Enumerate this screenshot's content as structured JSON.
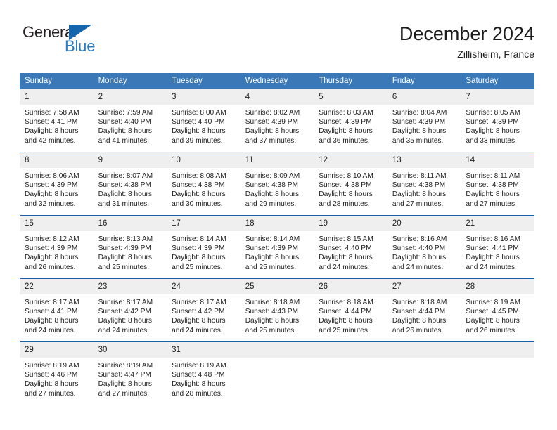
{
  "brand": {
    "name_top": "General",
    "name_bottom": "Blue",
    "triangle_icon": "blue-triangle-icon",
    "color_dark": "#231f20",
    "color_blue": "#2b7cc3"
  },
  "header": {
    "title": "December 2024",
    "location": "Zillisheim, France",
    "accent_color": "#3a78b8",
    "separator_color": "#1a5ea8",
    "daynum_band_color": "#efefef"
  },
  "weekday_headers": [
    "Sunday",
    "Monday",
    "Tuesday",
    "Wednesday",
    "Thursday",
    "Friday",
    "Saturday"
  ],
  "weeks": [
    [
      {
        "day": "1",
        "sunrise": "Sunrise: 7:58 AM",
        "sunset": "Sunset: 4:41 PM",
        "daylight1": "Daylight: 8 hours",
        "daylight2": "and 42 minutes."
      },
      {
        "day": "2",
        "sunrise": "Sunrise: 7:59 AM",
        "sunset": "Sunset: 4:40 PM",
        "daylight1": "Daylight: 8 hours",
        "daylight2": "and 41 minutes."
      },
      {
        "day": "3",
        "sunrise": "Sunrise: 8:00 AM",
        "sunset": "Sunset: 4:40 PM",
        "daylight1": "Daylight: 8 hours",
        "daylight2": "and 39 minutes."
      },
      {
        "day": "4",
        "sunrise": "Sunrise: 8:02 AM",
        "sunset": "Sunset: 4:39 PM",
        "daylight1": "Daylight: 8 hours",
        "daylight2": "and 37 minutes."
      },
      {
        "day": "5",
        "sunrise": "Sunrise: 8:03 AM",
        "sunset": "Sunset: 4:39 PM",
        "daylight1": "Daylight: 8 hours",
        "daylight2": "and 36 minutes."
      },
      {
        "day": "6",
        "sunrise": "Sunrise: 8:04 AM",
        "sunset": "Sunset: 4:39 PM",
        "daylight1": "Daylight: 8 hours",
        "daylight2": "and 35 minutes."
      },
      {
        "day": "7",
        "sunrise": "Sunrise: 8:05 AM",
        "sunset": "Sunset: 4:39 PM",
        "daylight1": "Daylight: 8 hours",
        "daylight2": "and 33 minutes."
      }
    ],
    [
      {
        "day": "8",
        "sunrise": "Sunrise: 8:06 AM",
        "sunset": "Sunset: 4:39 PM",
        "daylight1": "Daylight: 8 hours",
        "daylight2": "and 32 minutes."
      },
      {
        "day": "9",
        "sunrise": "Sunrise: 8:07 AM",
        "sunset": "Sunset: 4:38 PM",
        "daylight1": "Daylight: 8 hours",
        "daylight2": "and 31 minutes."
      },
      {
        "day": "10",
        "sunrise": "Sunrise: 8:08 AM",
        "sunset": "Sunset: 4:38 PM",
        "daylight1": "Daylight: 8 hours",
        "daylight2": "and 30 minutes."
      },
      {
        "day": "11",
        "sunrise": "Sunrise: 8:09 AM",
        "sunset": "Sunset: 4:38 PM",
        "daylight1": "Daylight: 8 hours",
        "daylight2": "and 29 minutes."
      },
      {
        "day": "12",
        "sunrise": "Sunrise: 8:10 AM",
        "sunset": "Sunset: 4:38 PM",
        "daylight1": "Daylight: 8 hours",
        "daylight2": "and 28 minutes."
      },
      {
        "day": "13",
        "sunrise": "Sunrise: 8:11 AM",
        "sunset": "Sunset: 4:38 PM",
        "daylight1": "Daylight: 8 hours",
        "daylight2": "and 27 minutes."
      },
      {
        "day": "14",
        "sunrise": "Sunrise: 8:11 AM",
        "sunset": "Sunset: 4:38 PM",
        "daylight1": "Daylight: 8 hours",
        "daylight2": "and 27 minutes."
      }
    ],
    [
      {
        "day": "15",
        "sunrise": "Sunrise: 8:12 AM",
        "sunset": "Sunset: 4:39 PM",
        "daylight1": "Daylight: 8 hours",
        "daylight2": "and 26 minutes."
      },
      {
        "day": "16",
        "sunrise": "Sunrise: 8:13 AM",
        "sunset": "Sunset: 4:39 PM",
        "daylight1": "Daylight: 8 hours",
        "daylight2": "and 25 minutes."
      },
      {
        "day": "17",
        "sunrise": "Sunrise: 8:14 AM",
        "sunset": "Sunset: 4:39 PM",
        "daylight1": "Daylight: 8 hours",
        "daylight2": "and 25 minutes."
      },
      {
        "day": "18",
        "sunrise": "Sunrise: 8:14 AM",
        "sunset": "Sunset: 4:39 PM",
        "daylight1": "Daylight: 8 hours",
        "daylight2": "and 25 minutes."
      },
      {
        "day": "19",
        "sunrise": "Sunrise: 8:15 AM",
        "sunset": "Sunset: 4:40 PM",
        "daylight1": "Daylight: 8 hours",
        "daylight2": "and 24 minutes."
      },
      {
        "day": "20",
        "sunrise": "Sunrise: 8:16 AM",
        "sunset": "Sunset: 4:40 PM",
        "daylight1": "Daylight: 8 hours",
        "daylight2": "and 24 minutes."
      },
      {
        "day": "21",
        "sunrise": "Sunrise: 8:16 AM",
        "sunset": "Sunset: 4:41 PM",
        "daylight1": "Daylight: 8 hours",
        "daylight2": "and 24 minutes."
      }
    ],
    [
      {
        "day": "22",
        "sunrise": "Sunrise: 8:17 AM",
        "sunset": "Sunset: 4:41 PM",
        "daylight1": "Daylight: 8 hours",
        "daylight2": "and 24 minutes."
      },
      {
        "day": "23",
        "sunrise": "Sunrise: 8:17 AM",
        "sunset": "Sunset: 4:42 PM",
        "daylight1": "Daylight: 8 hours",
        "daylight2": "and 24 minutes."
      },
      {
        "day": "24",
        "sunrise": "Sunrise: 8:17 AM",
        "sunset": "Sunset: 4:42 PM",
        "daylight1": "Daylight: 8 hours",
        "daylight2": "and 24 minutes."
      },
      {
        "day": "25",
        "sunrise": "Sunrise: 8:18 AM",
        "sunset": "Sunset: 4:43 PM",
        "daylight1": "Daylight: 8 hours",
        "daylight2": "and 25 minutes."
      },
      {
        "day": "26",
        "sunrise": "Sunrise: 8:18 AM",
        "sunset": "Sunset: 4:44 PM",
        "daylight1": "Daylight: 8 hours",
        "daylight2": "and 25 minutes."
      },
      {
        "day": "27",
        "sunrise": "Sunrise: 8:18 AM",
        "sunset": "Sunset: 4:44 PM",
        "daylight1": "Daylight: 8 hours",
        "daylight2": "and 26 minutes."
      },
      {
        "day": "28",
        "sunrise": "Sunrise: 8:19 AM",
        "sunset": "Sunset: 4:45 PM",
        "daylight1": "Daylight: 8 hours",
        "daylight2": "and 26 minutes."
      }
    ],
    [
      {
        "day": "29",
        "sunrise": "Sunrise: 8:19 AM",
        "sunset": "Sunset: 4:46 PM",
        "daylight1": "Daylight: 8 hours",
        "daylight2": "and 27 minutes."
      },
      {
        "day": "30",
        "sunrise": "Sunrise: 8:19 AM",
        "sunset": "Sunset: 4:47 PM",
        "daylight1": "Daylight: 8 hours",
        "daylight2": "and 27 minutes."
      },
      {
        "day": "31",
        "sunrise": "Sunrise: 8:19 AM",
        "sunset": "Sunset: 4:48 PM",
        "daylight1": "Daylight: 8 hours",
        "daylight2": "and 28 minutes."
      },
      {
        "day": "",
        "sunrise": "",
        "sunset": "",
        "daylight1": "",
        "daylight2": ""
      },
      {
        "day": "",
        "sunrise": "",
        "sunset": "",
        "daylight1": "",
        "daylight2": ""
      },
      {
        "day": "",
        "sunrise": "",
        "sunset": "",
        "daylight1": "",
        "daylight2": ""
      },
      {
        "day": "",
        "sunrise": "",
        "sunset": "",
        "daylight1": "",
        "daylight2": ""
      }
    ]
  ]
}
